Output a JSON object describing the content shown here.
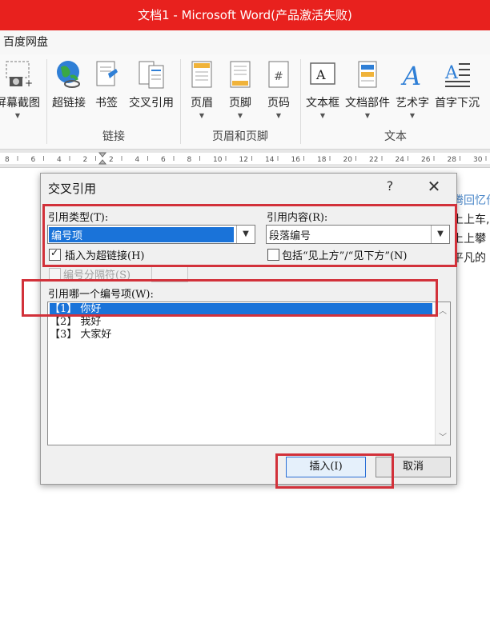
{
  "window": {
    "title": "文档1 - Microsoft Word(产品激活失败)"
  },
  "menubar": {
    "item": "百度网盘"
  },
  "ribbon": {
    "buttons": [
      {
        "label": "屏幕截图",
        "icon": "screenshot-icon"
      },
      {
        "label": "超链接",
        "icon": "hyperlink-globe-icon"
      },
      {
        "label": "书签",
        "icon": "bookmark-icon"
      },
      {
        "label": "交叉引用",
        "icon": "cross-reference-icon"
      },
      {
        "label": "页眉",
        "icon": "header-icon"
      },
      {
        "label": "页脚",
        "icon": "footer-icon"
      },
      {
        "label": "页码",
        "icon": "page-number-icon"
      },
      {
        "label": "文本框",
        "icon": "textbox-icon"
      },
      {
        "label": "文档部件",
        "icon": "quick-parts-icon"
      },
      {
        "label": "艺术字",
        "icon": "wordart-icon"
      },
      {
        "label": "首字下沉",
        "icon": "drop-cap-icon"
      }
    ],
    "groups": {
      "links": "链接",
      "header_footer": "页眉和页脚",
      "text": "文本"
    }
  },
  "ruler": {
    "ticks": [
      "8",
      "6",
      "4",
      "2",
      "2",
      "4",
      "6",
      "8",
      "10",
      "12",
      "14",
      "16",
      "18",
      "20",
      "22",
      "24",
      "26",
      "28",
      "30"
    ]
  },
  "document": {
    "fragments": [
      "腾回忆作",
      "上上车,",
      "上上攀",
      "平凡的"
    ]
  },
  "dialog": {
    "title": "交叉引用",
    "help": "?",
    "close": "✕",
    "ref_type_label": "引用类型(T):",
    "ref_type_value": "编号项",
    "ref_content_label": "引用内容(R):",
    "ref_content_value": "段落编号",
    "insert_hyperlink_label": "插入为超链接(H)",
    "insert_hyperlink_checked": true,
    "include_above_below_label": "包括“见上方”/“见下方”(N)",
    "include_above_below_checked": false,
    "separator_label": "编号分隔符(S)",
    "which_label": "引用哪一个编号项(W):",
    "items": [
      "【1】 你好",
      "【2】 我好",
      "【3】 大家好"
    ],
    "selected_index": 0,
    "insert_button": "插入(I)",
    "cancel_button": "取消"
  },
  "colors": {
    "titlebar": "#e8211e",
    "selection": "#1a73d9",
    "highlight_box": "#d2313a"
  }
}
